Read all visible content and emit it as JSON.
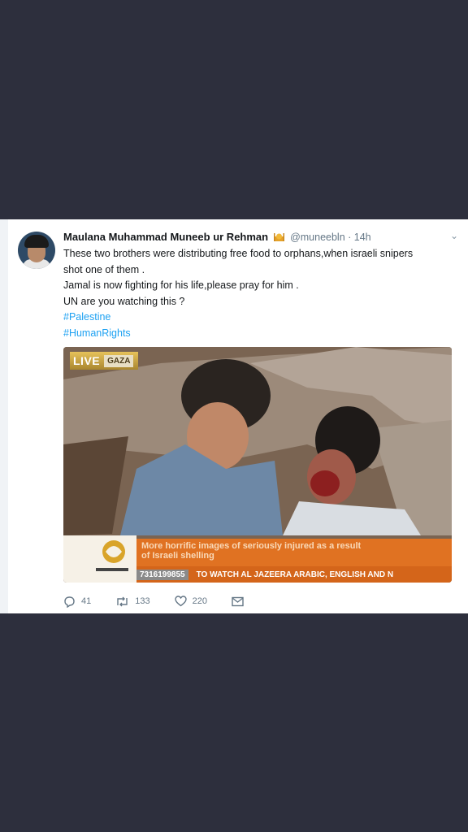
{
  "tweet": {
    "author_name": "Maulana Muhammad Muneeb ur Rehman",
    "handle": "@muneebln",
    "time": "14h",
    "text_lines": [
      "These two brothers were distributing free food to orphans,when israeli snipers",
      "shot one of them .",
      "Jamal is now fighting for his life,please pray for him .",
      "UN are you watching this ?"
    ],
    "hashtags": [
      "#Palestine",
      "#HumanRights"
    ]
  },
  "media": {
    "live_label": "LIVE",
    "location_label": "GAZA",
    "ticker_headline_1": "More horrific images of seriously injured as a result",
    "ticker_headline_2": "of Israeli shelling",
    "phone_number": "7316199855",
    "ticker_crawl": "TO WATCH AL JAZEERA ARABIC, ENGLISH AND N"
  },
  "actions": {
    "replies": "41",
    "retweets": "133",
    "likes": "220"
  },
  "colors": {
    "background": "#2d2f3d",
    "hashtag": "#1da1f2",
    "ticker_orange": "#e07222"
  },
  "icons": [
    "chevron-down-icon",
    "reply-icon",
    "retweet-icon",
    "like-icon",
    "dm-icon"
  ]
}
